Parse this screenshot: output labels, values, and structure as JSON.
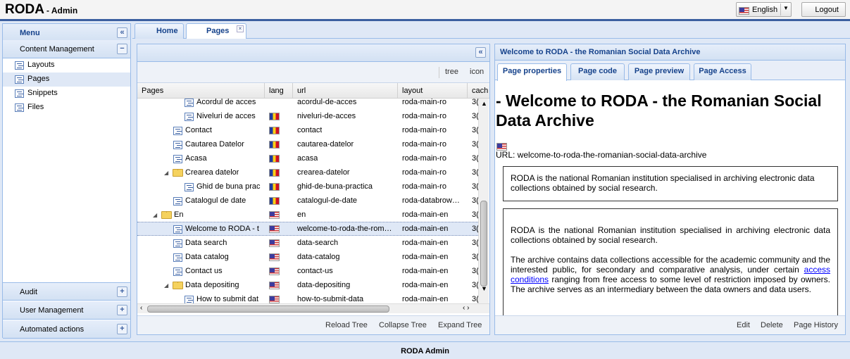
{
  "app": {
    "title": "RODA",
    "subtitle": "- Admin"
  },
  "header": {
    "language": "English",
    "logout": "Logout"
  },
  "menu": {
    "title": "Menu",
    "sections": [
      {
        "label": "Content Management",
        "toggle": "−"
      },
      {
        "label": "Audit",
        "toggle": "+"
      },
      {
        "label": "User Management",
        "toggle": "+"
      },
      {
        "label": "Automated actions",
        "toggle": "+"
      }
    ],
    "items": [
      "Layouts",
      "Pages",
      "Snippets",
      "Files"
    ]
  },
  "tabs": [
    "Home",
    "Pages"
  ],
  "pages_panel": {
    "toolbar": {
      "tree": "tree",
      "icon": "icon"
    },
    "columns": [
      "Pages",
      "lang",
      "url",
      "layout",
      "cach"
    ],
    "rows": [
      {
        "name": "Acordul de acces",
        "lang": "",
        "url": "acordul-de-acces",
        "layout": "roda-main-ro",
        "cache": "3("
      },
      {
        "name": "Niveluri de acces",
        "lang": "ro",
        "url": "niveluri-de-acces",
        "layout": "roda-main-ro",
        "cache": "3("
      },
      {
        "name": "Contact",
        "lang": "ro",
        "url": "contact",
        "layout": "roda-main-ro",
        "cache": "3("
      },
      {
        "name": "Cautarea Datelor",
        "lang": "ro",
        "url": "cautarea-datelor",
        "layout": "roda-main-ro",
        "cache": "3("
      },
      {
        "name": "Acasa",
        "lang": "ro",
        "url": "acasa",
        "layout": "roda-main-ro",
        "cache": "3("
      },
      {
        "name": "Crearea datelor",
        "lang": "ro",
        "url": "crearea-datelor",
        "layout": "roda-main-ro",
        "cache": "3("
      },
      {
        "name": "Ghid de buna prac",
        "lang": "ro",
        "url": "ghid-de-buna-practica",
        "layout": "roda-main-ro",
        "cache": "3("
      },
      {
        "name": "Catalogul de date",
        "lang": "ro",
        "url": "catalogul-de-date",
        "layout": "roda-databrow…",
        "cache": "3("
      },
      {
        "name": "En",
        "lang": "en",
        "url": "en",
        "layout": "roda-main-en",
        "cache": "3("
      },
      {
        "name": "Welcome to RODA - t",
        "lang": "en",
        "url": "welcome-to-roda-the-rom…",
        "layout": "roda-main-en",
        "cache": "3("
      },
      {
        "name": "Data search",
        "lang": "en",
        "url": "data-search",
        "layout": "roda-main-en",
        "cache": "3("
      },
      {
        "name": "Data catalog",
        "lang": "en",
        "url": "data-catalog",
        "layout": "roda-main-en",
        "cache": "3("
      },
      {
        "name": "Contact us",
        "lang": "en",
        "url": "contact-us",
        "layout": "roda-main-en",
        "cache": "3("
      },
      {
        "name": "Data depositing",
        "lang": "en",
        "url": "data-depositing",
        "layout": "roda-main-en",
        "cache": "3("
      },
      {
        "name": "How to submit dat",
        "lang": "en",
        "url": "how-to-submit-data",
        "layout": "roda-main-en",
        "cache": "3("
      }
    ],
    "footer": {
      "reload": "Reload Tree",
      "collapse": "Collapse Tree",
      "expand": "Expand Tree"
    }
  },
  "detail": {
    "title": "Welcome to RODA - the Romanian Social Data Archive",
    "tabs": [
      "Page properties",
      "Page code",
      "Page preview",
      "Page Access"
    ],
    "heading": "- Welcome to RODA - the Romanian Social Data Archive",
    "url_line": "URL: welcome-to-roda-the-romanian-social-data-archive",
    "box1": "RODA is the national Romanian institution specialised in archiving electronic data collections obtained by social research.",
    "box2_p1": "RODA is the national Romanian institution specialised in archiving electronic data collections obtained by social research.",
    "box2_p2_a": "The archive contains data collections accessible for the academic community and the interested public, for secondary and comparative analysis, under certain",
    "box2_link": "access conditions",
    "box2_p2_b": "ranging from free access to some level of restriction imposed by owners. The archive serves as an intermediary between the data owners and data users.",
    "footer": {
      "edit": "Edit",
      "delete": "Delete",
      "history": "Page History"
    }
  },
  "footer": {
    "text": "RODA Admin"
  }
}
